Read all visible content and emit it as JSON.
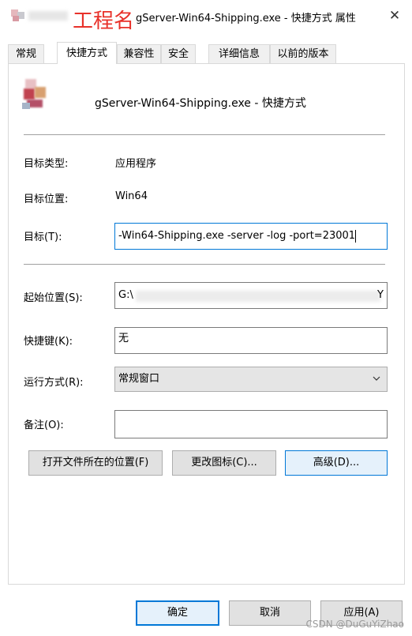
{
  "window": {
    "title": "gServer-Win64-Shipping.exe - 快捷方式 属性",
    "annotation": "工程名"
  },
  "tabs": [
    {
      "label": "常规"
    },
    {
      "label": "快捷方式"
    },
    {
      "label": "兼容性"
    },
    {
      "label": "安全"
    },
    {
      "label": "详细信息"
    },
    {
      "label": "以前的版本"
    }
  ],
  "shortcut": {
    "name": "gServer-Win64-Shipping.exe - 快捷方式",
    "target_type_label": "目标类型:",
    "target_type_value": "应用程序",
    "target_location_label": "目标位置:",
    "target_location_value": "Win64",
    "target_label": "目标(T):",
    "target_value": "-Win64-Shipping.exe -server -log -port=23001",
    "start_in_label": "起始位置(S):",
    "start_in_value": "G:\\",
    "start_in_suffix": "Y",
    "hotkey_label": "快捷键(K):",
    "hotkey_value": "无",
    "run_label": "运行方式(R):",
    "run_value": "常规窗口",
    "comment_label": "备注(O):",
    "comment_value": ""
  },
  "buttons": {
    "open_location": "打开文件所在的位置(F)",
    "change_icon": "更改图标(C)...",
    "advanced": "高级(D)...",
    "ok": "确定",
    "cancel": "取消",
    "apply": "应用(A)"
  },
  "watermark": "CSDN @DuGuYiZhao"
}
